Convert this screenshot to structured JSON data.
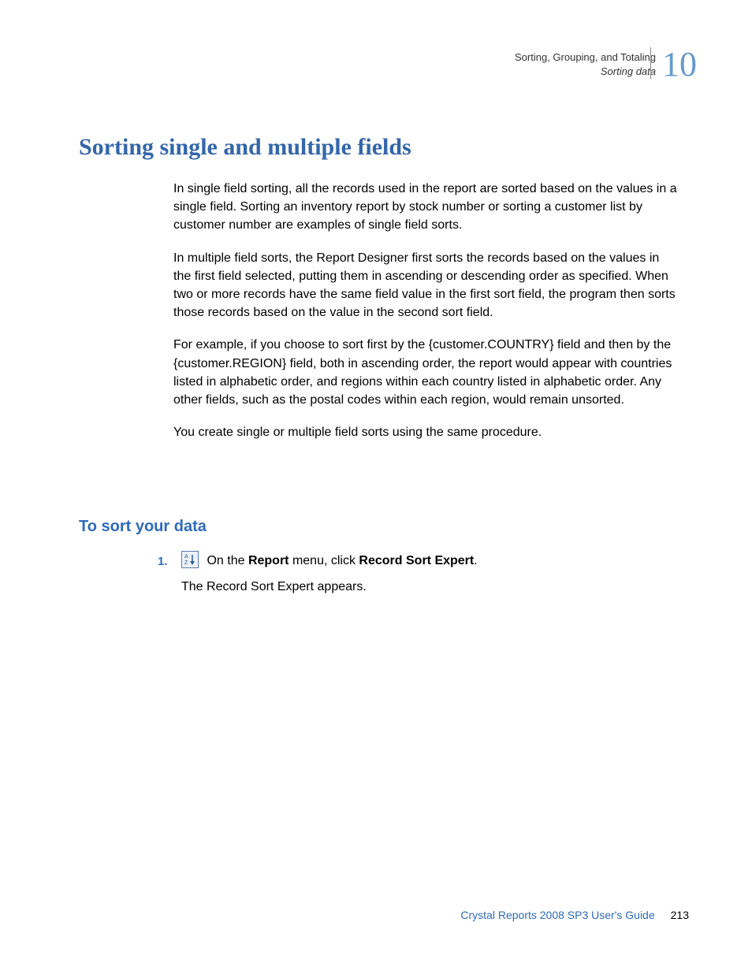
{
  "header": {
    "section_title": "Sorting, Grouping, and Totaling",
    "subsection": "Sorting data",
    "chapter_number": "10"
  },
  "title": "Sorting single and multiple fields",
  "paragraphs": {
    "p1": "In single field sorting, all the records used in the report are sorted based on the values in a single field. Sorting an inventory report by stock number or sorting a customer list by customer number are examples of single field sorts.",
    "p2": "In multiple field sorts, the Report Designer first sorts the records based on the values in the first field selected, putting them in ascending or descending order as specified. When two or more records have the same field value in the first sort field, the program then sorts those records based on the value in the second sort field.",
    "p3": "For example, if you choose to sort first by the {customer.COUNTRY} field and then by the {customer.REGION} field, both in ascending order, the report would appear with countries listed in alphabetic order, and regions within each country listed in alphabetic order. Any other fields, such as the postal codes within each region, would remain unsorted.",
    "p4": "You create single or multiple field sorts using the same procedure."
  },
  "subheading": "To sort your data",
  "step1": {
    "number": "1.",
    "pre": "On the ",
    "menu": "Report",
    "mid": " menu, click ",
    "action": "Record Sort Expert",
    "post": ".",
    "result": "The Record Sort Expert appears."
  },
  "footer": {
    "doc_title": "Crystal Reports 2008 SP3 User's Guide",
    "page_number": "213"
  }
}
